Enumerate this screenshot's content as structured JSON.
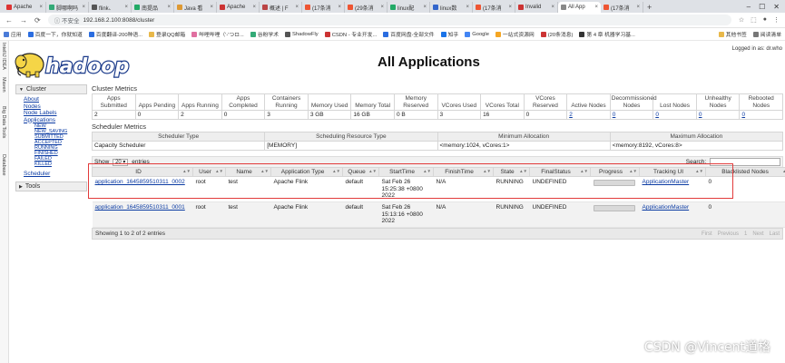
{
  "browser": {
    "tabs": [
      {
        "label": "Apache",
        "color": "#d33"
      },
      {
        "label": "脚哪啊吗",
        "color": "#3a7"
      },
      {
        "label": "flink、",
        "color": "#555"
      },
      {
        "label": "南提品",
        "color": "#2a6"
      },
      {
        "label": "Java 看",
        "color": "#d93"
      },
      {
        "label": "Apache",
        "color": "#c33"
      },
      {
        "label": "概述 | F",
        "color": "#b44"
      },
      {
        "label": "(17条消",
        "color": "#e53"
      },
      {
        "label": "(29条消",
        "color": "#e53"
      },
      {
        "label": "linux配",
        "color": "#2a6"
      },
      {
        "label": "linux数",
        "color": "#36c"
      },
      {
        "label": "(17条消",
        "color": "#e53"
      },
      {
        "label": "Invalid",
        "color": "#c33"
      },
      {
        "label": "All App",
        "color": "#888",
        "active": true
      },
      {
        "label": "(17条消",
        "color": "#e53"
      }
    ],
    "new_tab": "+",
    "nav": {
      "back": "←",
      "forward": "→",
      "reload": "⟳"
    },
    "url_warning": "ⓘ 不安全",
    "url": "192.168.2.100:8088/cluster",
    "bookmarks": [
      "应用",
      "百度一下，你就知道",
      "百度翻译-200种语...",
      "登录QQ邮箱",
      "哔哩哔哩（'-'つロ...",
      "谷粉学术",
      "ShadowFly",
      "CSDN - 专业开发...",
      "百度网盘-全部文件",
      "知乎",
      "Google",
      "一站式资源网",
      "(20条消息)",
      "第 4 章 机器学习基..."
    ],
    "bookmarks_right": [
      "其他书签",
      "阅读清单"
    ],
    "left_strip": [
      "IntelliJ IDEA",
      "Maven",
      "Big Data Tools",
      "Database"
    ]
  },
  "page": {
    "logo_text": "hadoop",
    "logged_in": "Logged in as: dr.who",
    "title": "All Applications"
  },
  "sidebar": {
    "cluster_label": "Cluster",
    "cluster_links": [
      "About",
      "Nodes",
      "Node Labels",
      "Applications"
    ],
    "app_states": [
      "NEW",
      "NEW_SAVING",
      "SUBMITTED",
      "ACCEPTED",
      "RUNNING",
      "FINISHED",
      "FAILED",
      "KILLED"
    ],
    "scheduler_link": "Scheduler",
    "tools_label": "Tools"
  },
  "cluster_metrics": {
    "title": "Cluster Metrics",
    "headers": [
      "Apps Submitted",
      "Apps Pending",
      "Apps Running",
      "Apps Completed",
      "Containers Running",
      "Memory Used",
      "Memory Total",
      "Memory Reserved",
      "VCores Used",
      "VCores Total",
      "VCores Reserved",
      "Active Nodes",
      "Decommissioned Nodes",
      "Lost Nodes",
      "Unhealthy Nodes",
      "Rebooted Nodes"
    ],
    "values": [
      "2",
      "0",
      "2",
      "0",
      "3",
      "3 GB",
      "16 GB",
      "0 B",
      "3",
      "16",
      "0",
      "2",
      "0",
      "0",
      "0",
      "0"
    ]
  },
  "scheduler_metrics": {
    "title": "Scheduler Metrics",
    "headers": [
      "Scheduler Type",
      "Scheduling Resource Type",
      "Minimum Allocation",
      "Maximum Allocation"
    ],
    "values": [
      "Capacity Scheduler",
      "[MEMORY]",
      "<memory:1024, vCores:1>",
      "<memory:8192, vCores:8>"
    ]
  },
  "apps_table": {
    "show_label": "Show",
    "entries_value": "20",
    "entries_label": "entries",
    "search_label": "Search:",
    "columns": [
      "ID",
      "User",
      "Name",
      "Application Type",
      "Queue",
      "StartTime",
      "FinishTime",
      "State",
      "FinalStatus",
      "Progress",
      "Tracking UI",
      "Blacklisted Nodes"
    ],
    "rows": [
      {
        "id": "application_1645859510311_0002",
        "user": "root",
        "name": "test",
        "type": "Apache Flink",
        "queue": "default",
        "start": "Sat Feb 26 15:25:38 +0800 2022",
        "finish": "N/A",
        "state": "RUNNING",
        "final": "UNDEFINED",
        "progress": 0.5,
        "tracking": "ApplicationMaster",
        "blacklisted": "0"
      },
      {
        "id": "application_1645859510311_0001",
        "user": "root",
        "name": "test",
        "type": "Apache Flink",
        "queue": "default",
        "start": "Sat Feb 26 15:13:16 +0800 2022",
        "finish": "N/A",
        "state": "RUNNING",
        "final": "UNDEFINED",
        "progress": 0.5,
        "tracking": "ApplicationMaster",
        "blacklisted": "0"
      }
    ],
    "footer_info": "Showing 1 to 2 of 2 entries",
    "pager": [
      "First",
      "Previous",
      "1",
      "Next",
      "Last"
    ]
  },
  "watermark": "CSDN @Vincent道格"
}
